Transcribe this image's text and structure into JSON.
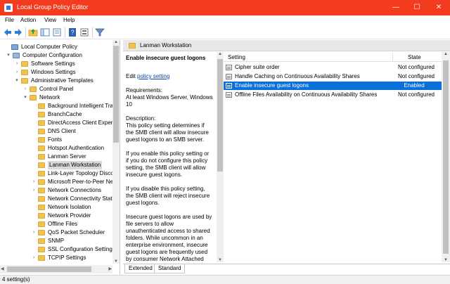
{
  "window": {
    "title": "Local Group Policy Editor",
    "controls": {
      "minimize": "—",
      "maximize": "☐",
      "close": "✕"
    }
  },
  "menu": [
    "File",
    "Action",
    "View",
    "Help"
  ],
  "toolbar": {
    "icons": [
      "back-icon",
      "forward-icon",
      "folder-up-icon",
      "show-hide-tree-icon",
      "export-list-icon",
      "help-icon",
      "properties-icon",
      "filter-icon"
    ]
  },
  "tree": {
    "items": [
      {
        "label": "Local Computer Policy",
        "level": 0,
        "expander": ""
      },
      {
        "label": "Computer Configuration",
        "level": 1,
        "expander": "▾"
      },
      {
        "label": "Software Settings",
        "level": 2,
        "expander": "›"
      },
      {
        "label": "Windows Settings",
        "level": 2,
        "expander": "›"
      },
      {
        "label": "Administrative Templates",
        "level": 2,
        "expander": "▾"
      },
      {
        "label": "Control Panel",
        "level": 3,
        "expander": "›"
      },
      {
        "label": "Network",
        "level": 3,
        "expander": "▾"
      },
      {
        "label": "Background Intelligent Tra",
        "level": 4,
        "expander": ""
      },
      {
        "label": "BranchCache",
        "level": 4,
        "expander": ""
      },
      {
        "label": "DirectAccess Client Experie",
        "level": 4,
        "expander": ""
      },
      {
        "label": "DNS Client",
        "level": 4,
        "expander": ""
      },
      {
        "label": "Fonts",
        "level": 4,
        "expander": ""
      },
      {
        "label": "Hotspot Authentication",
        "level": 4,
        "expander": ""
      },
      {
        "label": "Lanman Server",
        "level": 4,
        "expander": ""
      },
      {
        "label": "Lanman Workstation",
        "level": 4,
        "expander": "",
        "selected": true
      },
      {
        "label": "Link-Layer Topology Disco",
        "level": 4,
        "expander": ""
      },
      {
        "label": "Microsoft Peer-to-Peer Ne",
        "level": 4,
        "expander": "›"
      },
      {
        "label": "Network Connections",
        "level": 4,
        "expander": "›"
      },
      {
        "label": "Network Connectivity Stat",
        "level": 4,
        "expander": ""
      },
      {
        "label": "Network Isolation",
        "level": 4,
        "expander": ""
      },
      {
        "label": "Network Provider",
        "level": 4,
        "expander": ""
      },
      {
        "label": "Offline Files",
        "level": 4,
        "expander": ""
      },
      {
        "label": "QoS Packet Scheduler",
        "level": 4,
        "expander": "›"
      },
      {
        "label": "SNMP",
        "level": 4,
        "expander": ""
      },
      {
        "label": "SSL Configuration Settings",
        "level": 4,
        "expander": ""
      },
      {
        "label": "TCPIP Settings",
        "level": 4,
        "expander": "›"
      }
    ]
  },
  "pane": {
    "header": "Lanman Workstation",
    "description": {
      "heading": "Enable insecure guest logons",
      "edit_prefix": "Edit",
      "edit_link": "policy setting",
      "requirements_title": "Requirements:",
      "requirements_text": "At least Windows Server, Windows 10",
      "description_title": "Description:",
      "paragraphs": [
        "This policy setting determines if the SMB client will allow insecure guest logons to an SMB server.",
        "If you enable this policy setting or if you do not configure this policy setting, the SMB client will allow insecure guest logons.",
        "If you disable this policy setting, the SMB client will reject insecure guest logons.",
        "Insecure guest logons are used by file servers to allow unauthenticated access to shared folders. While uncommon in an enterprise environment, insecure guest logons are frequently used by consumer Network Attached"
      ]
    },
    "list": {
      "col_setting": "Setting",
      "col_state": "State",
      "rows": [
        {
          "name": "Cipher suite order",
          "state": "Not configured"
        },
        {
          "name": "Handle Caching on Continuous Availability Shares",
          "state": "Not configured"
        },
        {
          "name": "Enable insecure guest logons",
          "state": "Enabled",
          "selected": true
        },
        {
          "name": "Offline Files Availability on Continuous Availability Shares",
          "state": "Not configured"
        }
      ]
    },
    "tabs": [
      "Extended",
      "Standard"
    ]
  },
  "status": {
    "text": "4 setting(s)"
  },
  "colors": {
    "titlebar": "#f33b1f",
    "selection": "#0a6fd8",
    "folder": "#f2c14e"
  }
}
